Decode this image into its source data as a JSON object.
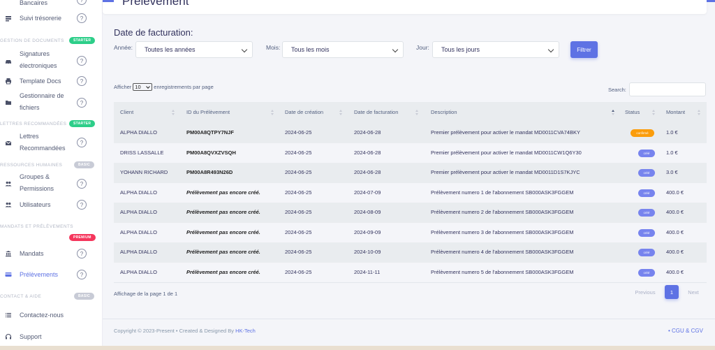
{
  "sidebar": {
    "items": [
      {
        "label_lines": [
          "Bancaires"
        ],
        "icon": "bank-icon"
      },
      {
        "label_lines": [
          "Suivi trésorerie"
        ],
        "icon": "treasury-icon"
      },
      {
        "label_lines": [
          "Signatures",
          "électroniques"
        ],
        "icon": "car-icon"
      },
      {
        "label_lines": [
          "Template Docs"
        ],
        "icon": "printer-icon"
      },
      {
        "label_lines": [
          "Gestionnaire de",
          "fichiers"
        ],
        "icon": "folder-icon"
      },
      {
        "label_lines": [
          "Lettres",
          "Recommandées"
        ],
        "icon": "mail-icon"
      },
      {
        "label_lines": [
          "Groupes &",
          "Permissions"
        ],
        "icon": "users-icon"
      },
      {
        "label_lines": [
          "Utilisateurs"
        ],
        "icon": "users-icon"
      },
      {
        "label_lines": [
          "Mandats"
        ],
        "icon": "bank-icon"
      },
      {
        "label_lines": [
          "Prélèvements"
        ],
        "icon": "card-icon"
      },
      {
        "label_lines": [
          "Contactez-nous"
        ],
        "icon": "list-icon"
      },
      {
        "label_lines": [
          "Support"
        ],
        "icon": "support-icon"
      }
    ],
    "help_glyph": "?",
    "sections": [
      {
        "title": "GESTION DE DOCUMENTS",
        "badge": "STARTER"
      },
      {
        "title": "LETTRES RECOMMANDÉES",
        "badge": "STARTER"
      },
      {
        "title": "RESSOURCES HUMAINES",
        "badge": "BASIC"
      },
      {
        "title": "MANDATS ET PRÉLÈVEMENTS",
        "badge": "PREMIUM"
      },
      {
        "title": "CONTACT & AIDE",
        "badge": "BASIC"
      }
    ]
  },
  "header": {
    "title": "Prélèvement"
  },
  "filters": {
    "title": "Date de facturation:",
    "year_label": "Année:",
    "year_value": "Toutes les années",
    "month_label": "Mois:",
    "month_value": "Tous les mois",
    "day_label": "Jour:",
    "day_value": "Tous les jours",
    "button": "Filtrer"
  },
  "table_controls": {
    "show_prefix": "Afficher",
    "show_value": "10",
    "show_suffix": "enregistrements par page",
    "search_label": "Search:"
  },
  "table": {
    "headers": [
      "Client",
      "ID du Prélèvement",
      "Date de création",
      "Date de facturation",
      "Description",
      "Status",
      "Montant"
    ],
    "rows": [
      {
        "client": "ALPHA DIALLO",
        "id": "PM00A8QTPY7NJF",
        "created": "2024-06-25",
        "billing": "2024-06-28",
        "description": "Premier prélèvement pour activer le mandat MD0011CVA74BKY",
        "status": "confirmé",
        "amount": "1.0 €"
      },
      {
        "client": "DRISS LASSALLE",
        "id": "PM00A8QVXZVSQH",
        "created": "2024-06-25",
        "billing": "2024-06-28",
        "description": "Premier prélèvement pour activer le mandat MD0011CW1Q6Y30",
        "status": "créé",
        "amount": "1.0 €"
      },
      {
        "client": "YOHANN RICHARD",
        "id": "PM00A8R493N26D",
        "created": "2024-06-25",
        "billing": "2024-06-28",
        "description": "Premier prélèvement pour activer le mandat MD0011D1S7KJYC",
        "status": "créé",
        "amount": "3.0 €"
      },
      {
        "client": "ALPHA DIALLO",
        "id": "Prélèvement pas encore créé.",
        "created": "2024-06-25",
        "billing": "2024-07-09",
        "description": "Prélèvement numero 1 de l'abonnement SB000ASK3FGGEM",
        "status": "créé",
        "amount": "400.0 €"
      },
      {
        "client": "ALPHA DIALLO",
        "id": "Prélèvement pas encore créé.",
        "created": "2024-06-25",
        "billing": "2024-08-09",
        "description": "Prélèvement numero 2 de l'abonnement SB000ASK3FGGEM",
        "status": "créé",
        "amount": "400.0 €"
      },
      {
        "client": "ALPHA DIALLO",
        "id": "Prélèvement pas encore créé.",
        "created": "2024-06-25",
        "billing": "2024-09-09",
        "description": "Prélèvement numero 3 de l'abonnement SB000ASK3FGGEM",
        "status": "créé",
        "amount": "400.0 €"
      },
      {
        "client": "ALPHA DIALLO",
        "id": "Prélèvement pas encore créé.",
        "created": "2024-06-25",
        "billing": "2024-10-09",
        "description": "Prélèvement numero 4 de l'abonnement SB000ASK3FGGEM",
        "status": "créé",
        "amount": "400.0 €"
      },
      {
        "client": "ALPHA DIALLO",
        "id": "Prélèvement pas encore créé.",
        "created": "2024-06-25",
        "billing": "2024-11-11",
        "description": "Prélèvement numero 5 de l'abonnement SB000ASK3FGGEM",
        "status": "créé",
        "amount": "400.0 €"
      }
    ]
  },
  "pagination": {
    "info": "Affichage de la page 1 de 1",
    "previous": "Previous",
    "current": "1",
    "next": "Next"
  },
  "footer": {
    "copyright_prefix": "Copyright © 2023-Present  •  Created & Designed By ",
    "brand": "HK-Tech",
    "links": "•  CGU & CGV"
  },
  "colors": {
    "accent": "#5e72e4",
    "confirmed": "#fb9d0c",
    "created": "#7784ee",
    "starter": "#2dce89",
    "premium": "#f5365c",
    "basic": "#c8cbd6"
  }
}
